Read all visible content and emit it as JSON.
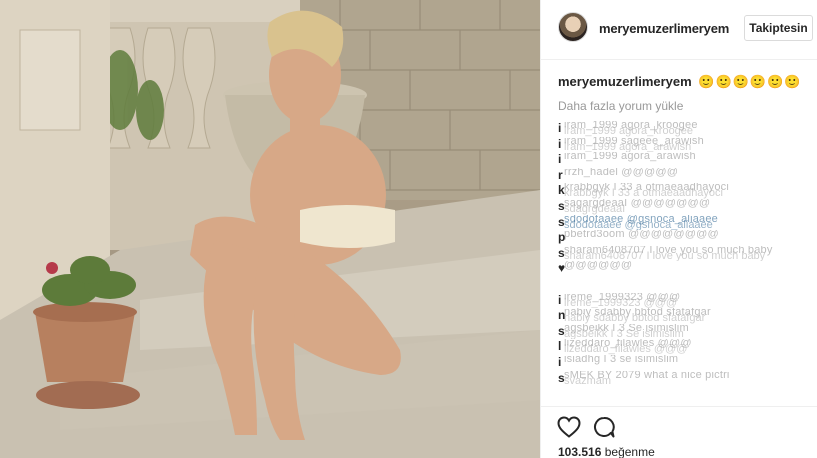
{
  "header": {
    "username": "meryemuzerlimeryem",
    "follow_label": "Takiptesin"
  },
  "caption": {
    "username": "meryemuzerlimeryem",
    "emojis": "🙂🙂🙂🙂🙂🙂"
  },
  "load_more_label": "Daha fazla yorum yükle",
  "comments": [
    {
      "user": "i",
      "text": "",
      "ghost": "iram_1999 agora_kroogee",
      "ghost2": "iram_1999 agora_kroogee"
    },
    {
      "user": "i",
      "text": "",
      "ghost": "iram_1999 sageee_arawish",
      "ghost2": "iram_1999 agora_arawish"
    },
    {
      "user": "i",
      "text": "",
      "ghost": "iram_1999 agora_arawish",
      "ghost2": ""
    },
    {
      "user": "r",
      "text": "",
      "ghost": "rrzh_hadel @@@@@",
      "ghost2": ""
    },
    {
      "user": "k",
      "text": "",
      "ghost": "krabbgyk I 33 a otmaeaadhayoci",
      "ghost2": "krabbgyk I 33 a otmaeaadhayoci"
    },
    {
      "user": "s",
      "text": "",
      "ghost": "sagargdeaaI @@@@@@@",
      "ghost2": "sdagrgdeaaI"
    },
    {
      "user": "s",
      "text": "",
      "ghost": "sdodotaaee @gsnoca_aliaaee",
      "ghost2": "sdodotaaee @gsnoca_aliaaee",
      "mention": true
    },
    {
      "user": "p",
      "text": "",
      "ghost": "pbetrd3oom @@@@@@@@",
      "ghost2": ""
    },
    {
      "user": "s",
      "text": "",
      "ghost": "sharam6408707 I love you so much baby",
      "ghost2": "sharam6408707 I love you so much baby"
    },
    {
      "user": "♥",
      "text": "",
      "ghost": "@@@@@@",
      "ghost2": ""
    },
    {
      "user": "",
      "text": "",
      "ghost": "",
      "ghost2": ""
    },
    {
      "user": "i",
      "text": "",
      "ghost": "ireme_1999323 @@@",
      "ghost2": "ireme_1999323 @@@"
    },
    {
      "user": "n",
      "text": "",
      "ghost": "nabiy sdabby bbtod sfatafgar",
      "ghost2": "nabiy sdabby bbtod sfatafgar"
    },
    {
      "user": "s",
      "text": "",
      "ghost": "agsbeikk I 3 Se isimislim",
      "ghost2": "agsbeikk I 3 Se isimislim"
    },
    {
      "user": "l",
      "text": "",
      "ghost": "lizeddaro_filawles @@@",
      "ghost2": "lizeddaro_filawles @@@"
    },
    {
      "user": "i",
      "text": "",
      "ghost": "isiadhg I 3 se isimislim",
      "ghost2": ""
    },
    {
      "user": "s",
      "text": "",
      "ghost": "sMEK BY 2079 what a nice pictri",
      "ghost2": "svazmam"
    }
  ],
  "likes": {
    "count": "103.516",
    "label": "beğenme"
  },
  "icons": {
    "like": "heart-icon",
    "comment": "comment-bubble-icon"
  }
}
